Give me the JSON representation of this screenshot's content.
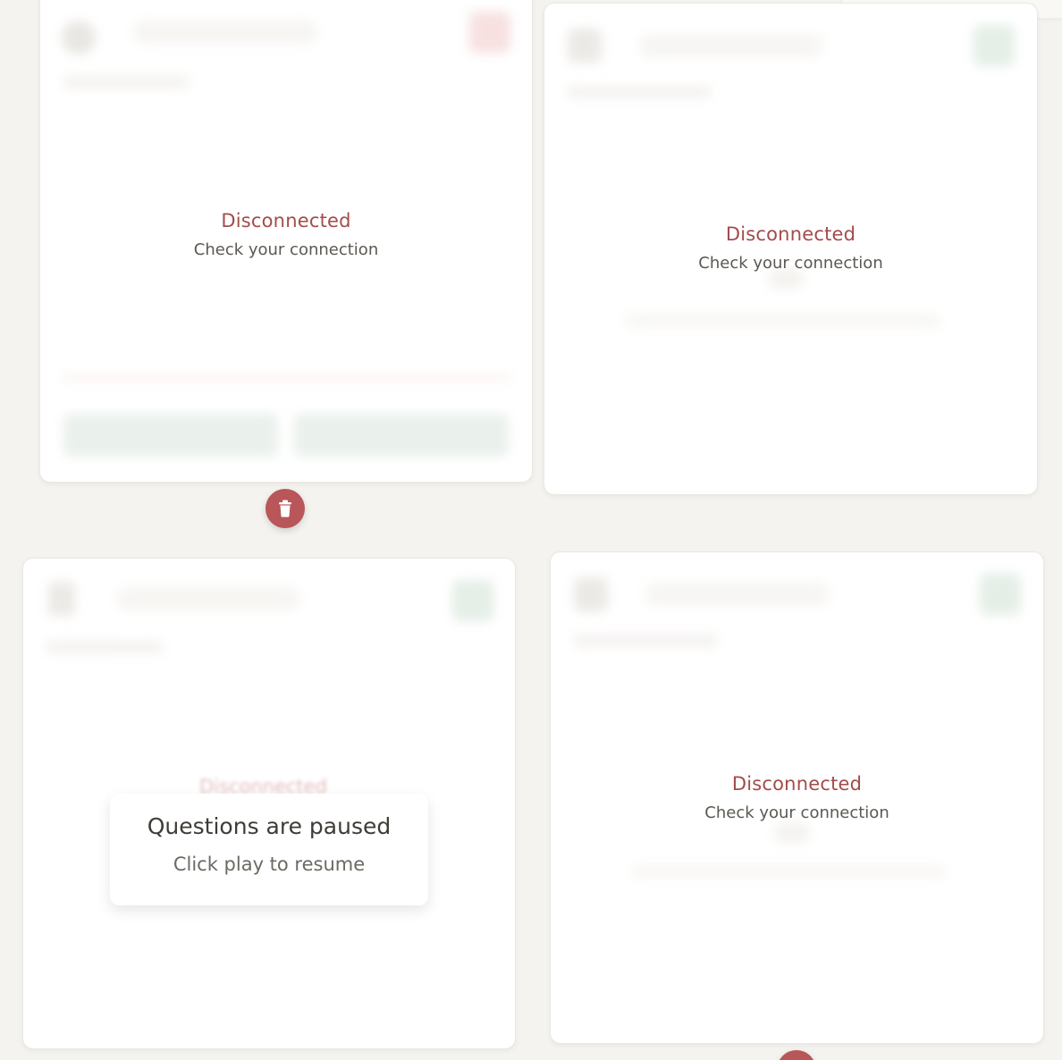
{
  "cards": [
    {
      "id": "card1",
      "status_title": "Disconnected",
      "status_subtitle": "Check your connection"
    },
    {
      "id": "card2",
      "status_title": "Disconnected",
      "status_subtitle": "Check your connection"
    },
    {
      "id": "card3",
      "ghost_title": "Disconnected"
    },
    {
      "id": "card4",
      "status_title": "Disconnected",
      "status_subtitle": "Check your connection"
    }
  ],
  "paused_popup": {
    "title": "Questions are paused",
    "subtitle": "Click play to resume"
  },
  "icons": {
    "delete": "trash-icon"
  },
  "colors": {
    "background": "#f4f3ef",
    "status_red": "#a44b4b",
    "delete_button": "#b9565a",
    "play_green": "#cfe1d3"
  }
}
